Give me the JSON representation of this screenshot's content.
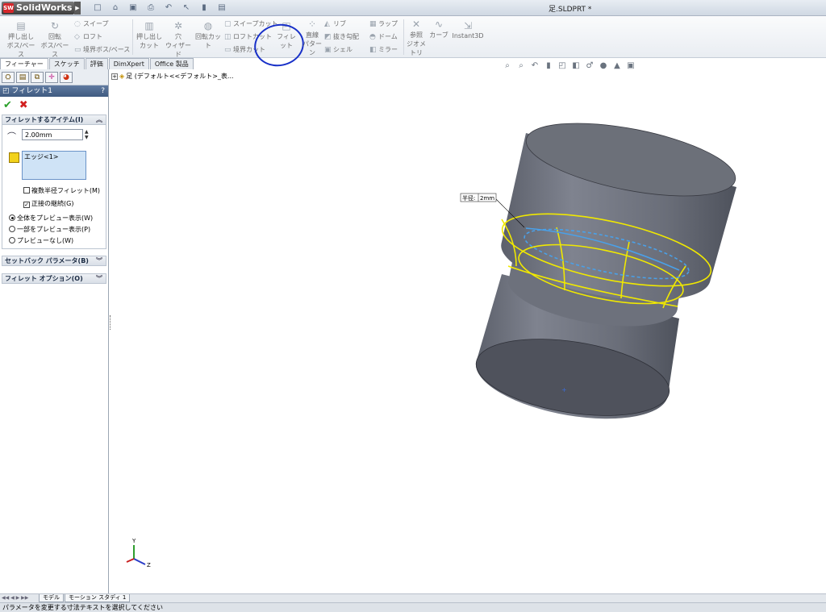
{
  "app": {
    "logo_text": "SolidWorks",
    "logo_badge": "SW",
    "document_title": "足.SLDPRT *"
  },
  "quickbar": [
    "new-icon",
    "open-icon",
    "save-icon",
    "print-icon",
    "undo-icon",
    "select-icon",
    "rebuild-icon",
    "options-icon"
  ],
  "command_manager": {
    "extrude_boss": "押し出し\nボス/ベース",
    "revolve_boss": "回転\nボス/ベース",
    "sweep": "スイープ",
    "loft": "ロフト",
    "boundary_boss": "境界ボス/ベース",
    "extrude_cut": "押し出し\nカット",
    "hole_wizard": "穴\nウィザード",
    "revolve_cut": "回転カット",
    "swept_cut": "スイープカット",
    "lofted_cut": "ロフトカット",
    "boundary_cut": "境界カット",
    "fillet": "フィレット",
    "linear_pattern": "直線\nパターン",
    "rib": "リブ",
    "draft": "抜き勾配",
    "shell": "シェル",
    "wrap": "ラップ",
    "dome": "ドーム",
    "mirror": "ミラー",
    "ref_geometry": "参照\nジオメトリ",
    "curves": "カーブ",
    "instant3d": "Instant3D"
  },
  "tabs": [
    "フィーチャー",
    "スケッチ",
    "評価",
    "DimXpert",
    "Office 製品"
  ],
  "property_manager": {
    "title": "フィレット1",
    "help": "?",
    "ok": "✔",
    "cancel": "✖",
    "items_group": "フィレットするアイテム(I)",
    "radius_value": "2.00mm",
    "edge_item": "エッジ<1>",
    "multi_radius": "複数半径フィレット(M)",
    "tangent_propagation": "正接の継続(G)",
    "tangent_checked": true,
    "preview_full": "全体をプレビュー表示(W)",
    "preview_partial": "一部をプレビュー表示(P)",
    "preview_none": "プレビューなし(W)",
    "setback_group": "セットバック パラメータ(B)",
    "options_group": "フィレット オプション(O)"
  },
  "viewport": {
    "tree_node": "足 (デフォルト<<デフォルト>_表...",
    "callout_label": "半径:",
    "callout_value": "2mm",
    "axis_y": "Y",
    "axis_z": "Z"
  },
  "bottom_tabs": [
    "モデル",
    "モーション スタディ 1"
  ],
  "status_text": "パラメータを変更する寸法テキストを選択してください"
}
